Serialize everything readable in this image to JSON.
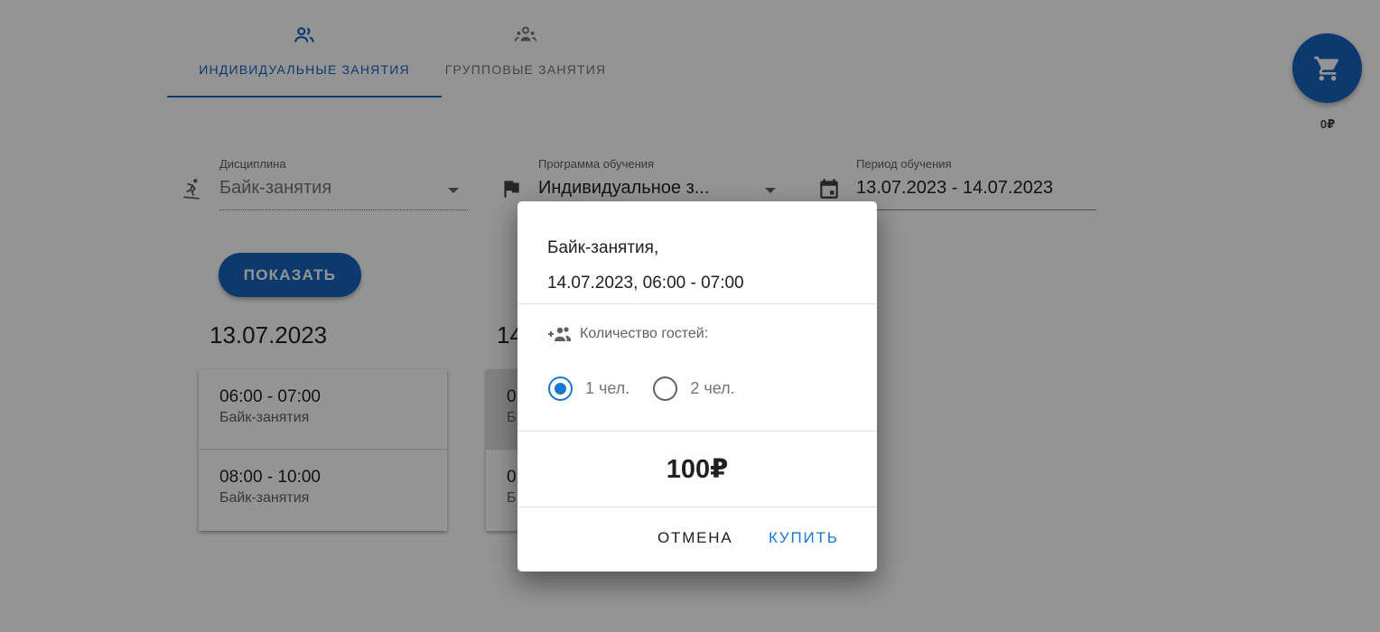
{
  "tabs": [
    {
      "label": "ИНДИВИДУАЛЬНЫЕ ЗАНЯТИЯ",
      "icon": "individual-people-icon",
      "active": true
    },
    {
      "label": "ГРУППОВЫЕ ЗАНЯТИЯ",
      "icon": "group-people-icon",
      "active": false
    }
  ],
  "cart": {
    "icon": "cart-icon",
    "total": "0₽"
  },
  "filters": {
    "discipline": {
      "label": "Дисциплина",
      "value": "Байк-занятия",
      "icon": "skier-icon"
    },
    "program": {
      "label": "Программа обучения",
      "value": "Индивидуальное з...",
      "icon": "flag-icon"
    },
    "period": {
      "label": "Период обучения",
      "value": "13.07.2023 - 14.07.2023",
      "icon": "calendar-icon"
    }
  },
  "show_button": "ПОКАЗАТЬ",
  "days": [
    {
      "date": "13.07.2023",
      "slots": [
        {
          "time": "06:00 - 07:00",
          "name": "Байк-занятия"
        },
        {
          "time": "08:00 - 10:00",
          "name": "Байк-занятия"
        }
      ]
    },
    {
      "date": "14",
      "slots": [
        {
          "time": "0",
          "name": "Б"
        },
        {
          "time": "0",
          "name": "Б"
        }
      ]
    }
  ],
  "dialog": {
    "title_line1": "Байк-занятия,",
    "title_line2": "14.07.2023, 06:00 - 07:00",
    "guests_label": "Количество гостей:",
    "guests_icon": "add-guests-icon",
    "options": [
      {
        "label": "1 чел.",
        "checked": true
      },
      {
        "label": "2 чел.",
        "checked": false
      }
    ],
    "price": "100₽",
    "cancel": "ОТМЕНА",
    "buy": "КУПИТЬ"
  },
  "colors": {
    "accent": "#1565c0",
    "dialog_accent": "#1976d2"
  }
}
